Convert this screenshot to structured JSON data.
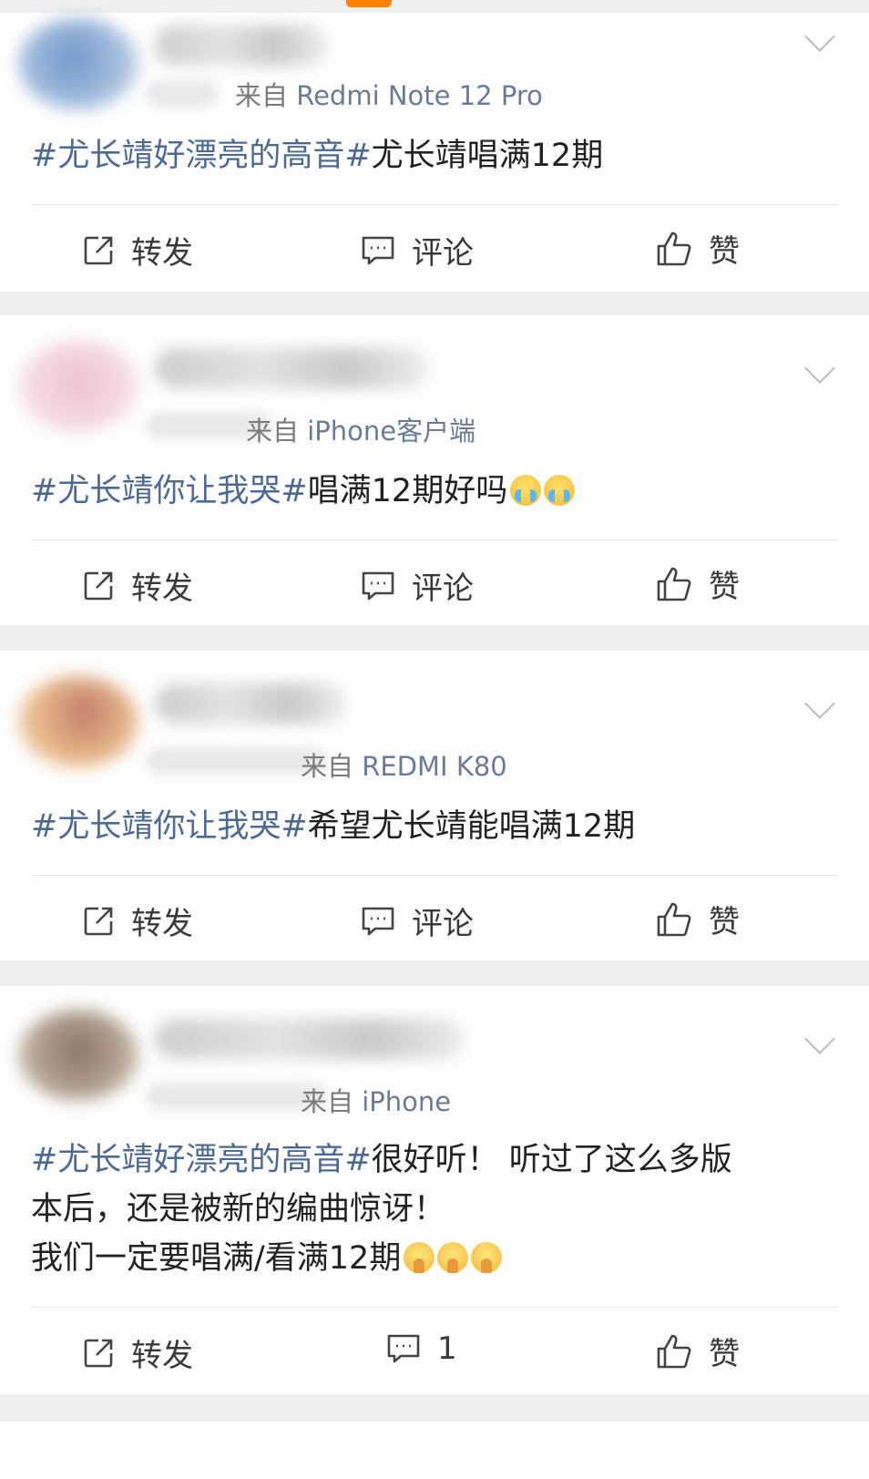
{
  "posts": [
    {
      "source_prefix": "来自",
      "device": "Redmi Note 12 Pro",
      "text": [
        {
          "t": "#尤长靖好漂亮的高音#",
          "topic": true
        },
        {
          "t": "尤长靖唱满12期",
          "topic": false
        }
      ],
      "actions": {
        "repost": "转发",
        "comment": "评论",
        "like": "赞"
      },
      "avatar_colors": [
        "#7fa6d6",
        "#b7c7dc"
      ]
    },
    {
      "source_prefix": "来自",
      "device": "iPhone客户端",
      "text": [
        {
          "t": "#尤长靖你让我哭#",
          "topic": true
        },
        {
          "t": "唱满12期好吗",
          "topic": false
        }
      ],
      "emoji": "crying",
      "actions": {
        "repost": "转发",
        "comment": "评论",
        "like": "赞"
      },
      "avatar_colors": [
        "#f1cfd8",
        "#f7e3e8"
      ]
    },
    {
      "source_prefix": "来自",
      "device": "REDMI K80",
      "text": [
        {
          "t": "#尤长靖你让我哭#",
          "topic": true
        },
        {
          "t": "希望尤长靖能唱满12期",
          "topic": false
        }
      ],
      "actions": {
        "repost": "转发",
        "comment": "评论",
        "like": "赞"
      },
      "avatar_colors": [
        "#e8b98a",
        "#c88f7a"
      ]
    },
    {
      "source_prefix": "来自",
      "device": "iPhone",
      "text": [
        {
          "t": "#尤长靖好漂亮的高音#",
          "topic": true
        },
        {
          "t": "很好听！ 听过了这么多版",
          "topic": false
        }
      ],
      "line2": "本后，还是被新的编曲惊讶！",
      "line3": "我们一定要唱满/看满12期",
      "emoji": "pray",
      "actions": {
        "repost": "转发",
        "comment": "1",
        "like": "赞"
      },
      "avatar_colors": [
        "#9a8a7c",
        "#c9beb3"
      ]
    }
  ],
  "colors": {
    "topic": "#4e6a93",
    "accent": "#ff8200",
    "background": "#f0f0f0"
  },
  "icons": {
    "repost": "share-square-icon",
    "comment": "comment-bubble-icon",
    "like": "thumbs-up-icon",
    "menu": "chevron-down-icon"
  }
}
